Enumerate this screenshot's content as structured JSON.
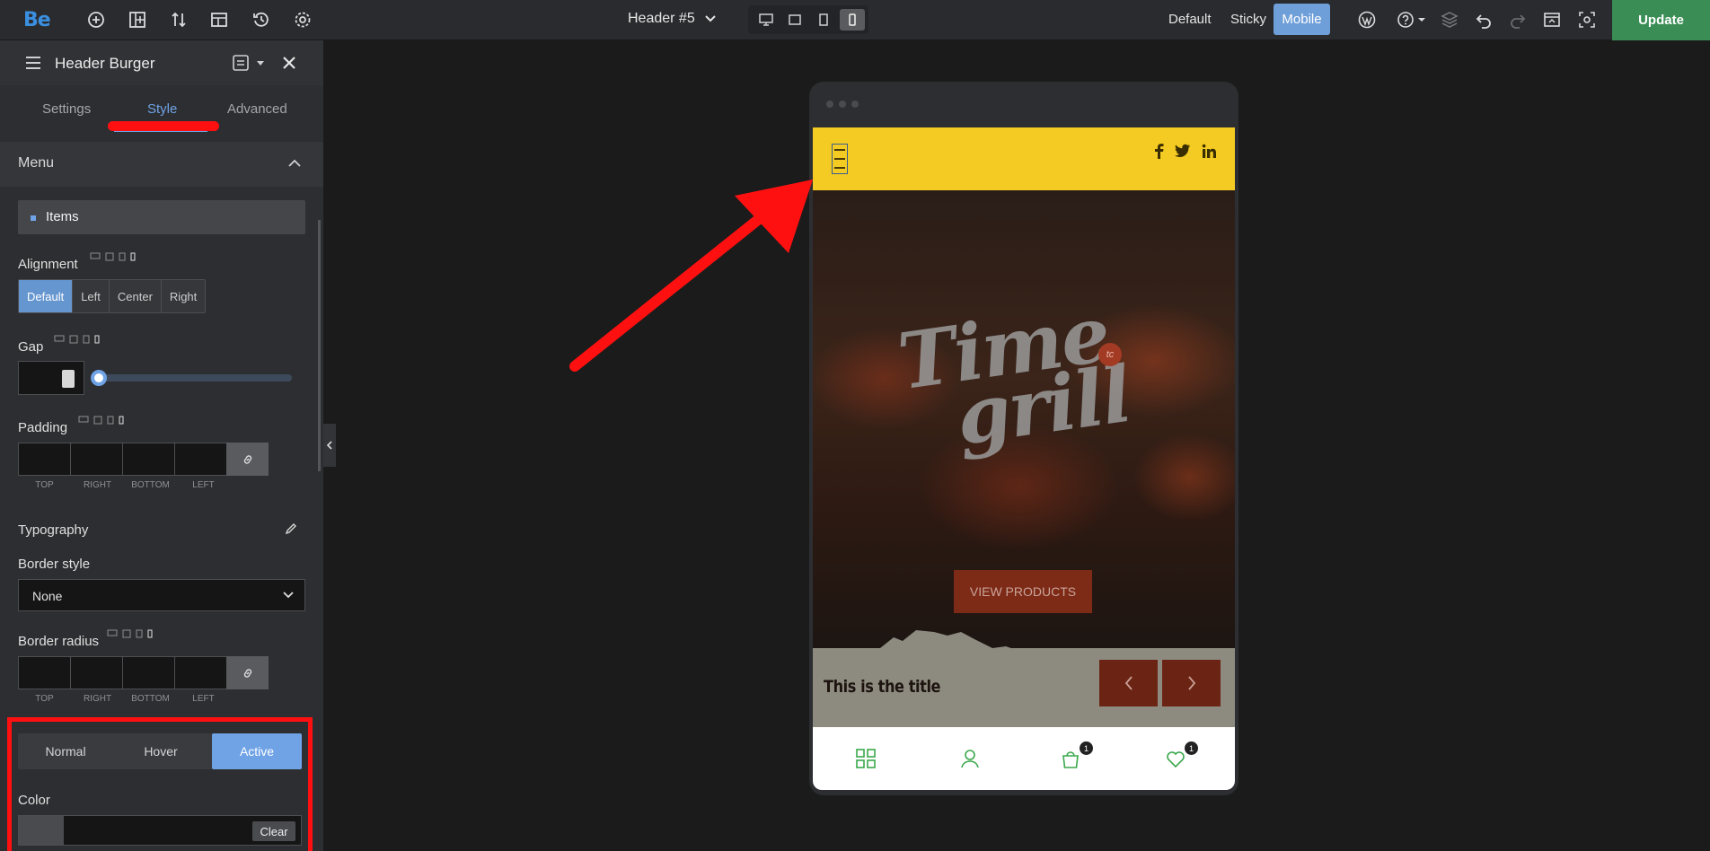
{
  "topbar": {
    "logo": "Be",
    "document_title": "Header #5",
    "modes": {
      "default": "Default",
      "sticky": "Sticky",
      "mobile": "Mobile"
    },
    "update_label": "Update"
  },
  "sidebar": {
    "title": "Header Burger",
    "tabs": {
      "settings": "Settings",
      "style": "Style",
      "advanced": "Advanced"
    },
    "section": "Menu",
    "items_label": "Items",
    "alignment": {
      "label": "Alignment",
      "options": [
        "Default",
        "Left",
        "Center",
        "Right"
      ],
      "selected": "Default"
    },
    "gap_label": "Gap",
    "padding_label": "Padding",
    "quad_labels": [
      "TOP",
      "RIGHT",
      "BOTTOM",
      "LEFT"
    ],
    "typography_label": "Typography",
    "border_style_label": "Border style",
    "border_style_value": "None",
    "border_radius_label": "Border radius",
    "states": [
      "Normal",
      "Hover",
      "Active"
    ],
    "active_state": "Active",
    "color_label": "Color",
    "clear_label": "Clear"
  },
  "preview": {
    "hero_logo_line1": "Time",
    "hero_logo_line2": "grill",
    "badge_text": "tc",
    "view_products": "VIEW PRODUCTS",
    "slide_title": "This is the title",
    "cart_count": "1",
    "wishlist_count": "1"
  },
  "colors": {
    "accent": "#6fa3e6",
    "update": "#3a8e55",
    "annotation": "#ff1010",
    "header_yellow": "#f4cb22",
    "bottom_icons": "#3aa84b"
  }
}
